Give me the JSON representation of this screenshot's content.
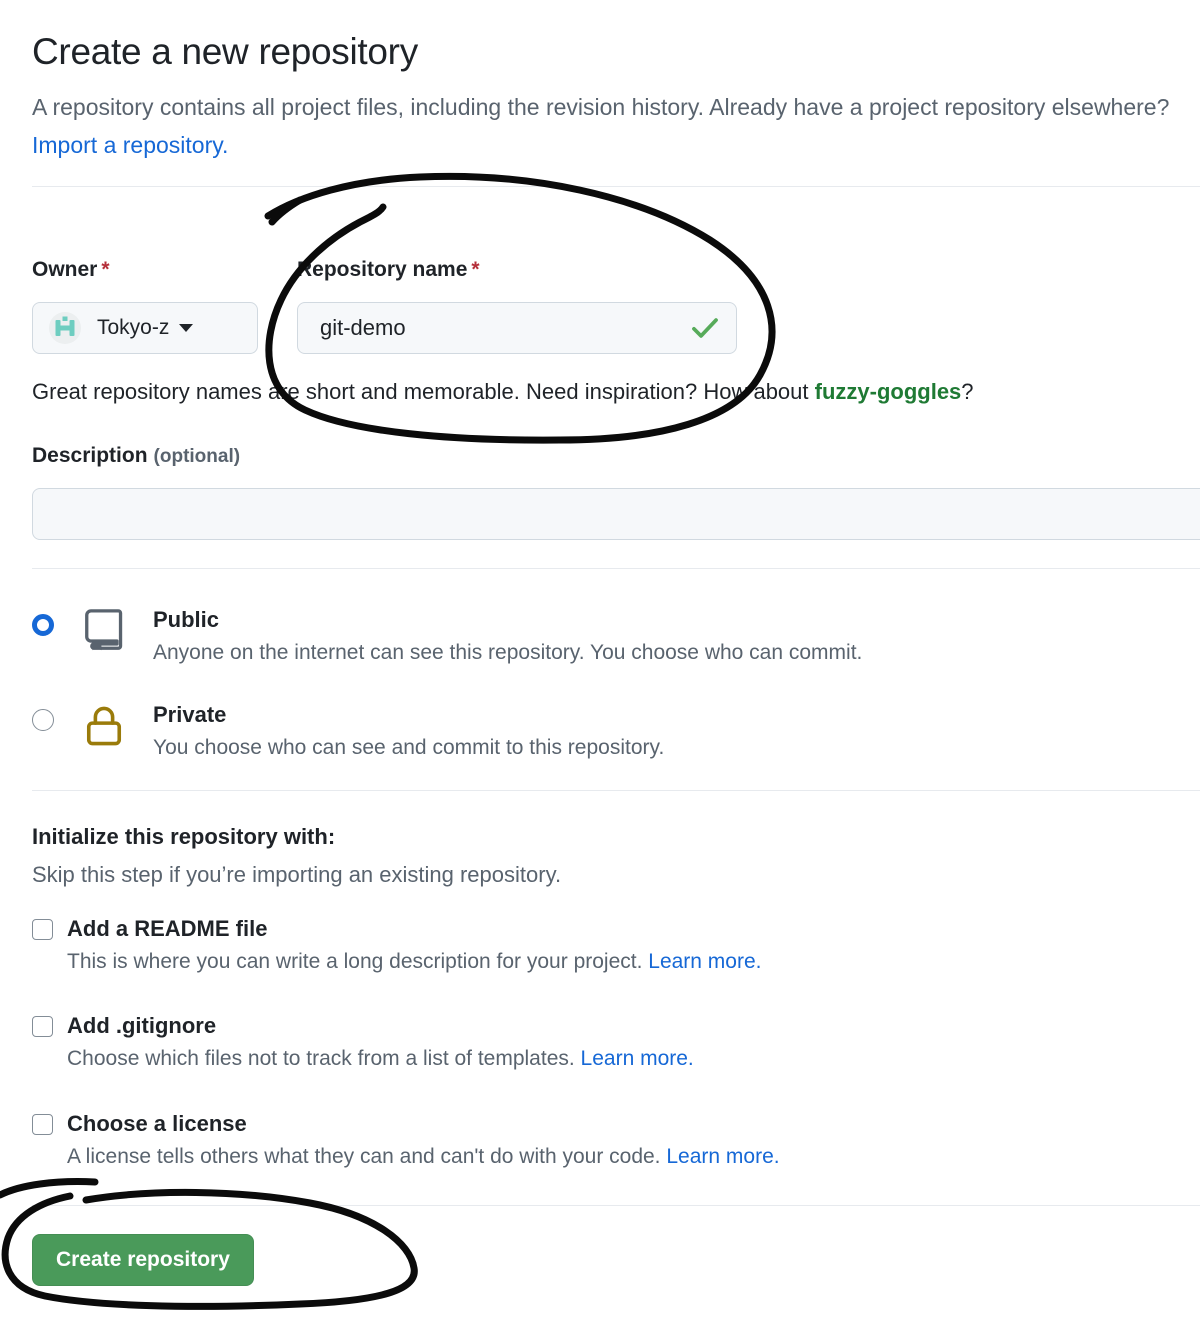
{
  "header": {
    "title": "Create a new repository",
    "subtitle_part1": "A repository contains all project files, including the revision history. Already have a project repository elsewhere? ",
    "subtitle_link": "Import a repository."
  },
  "owner": {
    "label": "Owner",
    "required_marker": "*",
    "value": "Tokyo-z",
    "avatar_icon": "user-avatar-identicon",
    "caret_icon": "chevron-down-icon"
  },
  "repository_name": {
    "label": "Repository name",
    "required_marker": "*",
    "value": "git-demo",
    "placeholder": "",
    "valid_icon": "check-icon",
    "valid_color": "#57ab5a"
  },
  "name_hint": {
    "text_before": "Great repository names are short and memorable. Need inspiration? How about ",
    "suggestion": "fuzzy-goggles",
    "text_after": "?"
  },
  "description": {
    "label": "Description",
    "optional_label": "(optional)",
    "value": "",
    "placeholder": ""
  },
  "visibility": {
    "options": [
      {
        "id": "public",
        "title": "Public",
        "description": "Anyone on the internet can see this repository. You choose who can commit.",
        "icon": "repo-book-icon",
        "icon_color": "#59636e",
        "selected": true
      },
      {
        "id": "private",
        "title": "Private",
        "description": "You choose who can see and commit to this repository.",
        "icon": "lock-icon",
        "icon_color": "#9a7b0a",
        "selected": false
      }
    ],
    "selected_color": "#1668d6"
  },
  "initialize": {
    "heading": "Initialize this repository with:",
    "subheading": "Skip this step if you’re importing an existing repository.",
    "items": [
      {
        "id": "readme",
        "title": "Add a README file",
        "description": "This is where you can write a long description for your project. ",
        "link": "Learn more.",
        "checked": false
      },
      {
        "id": "gitignore",
        "title": "Add .gitignore",
        "description": "Choose which files not to track from a list of templates. ",
        "link": "Learn more.",
        "checked": false
      },
      {
        "id": "license",
        "title": "Choose a license",
        "description": "A license tells others what they can and can't do with your code. ",
        "link": "Learn more.",
        "checked": false
      }
    ]
  },
  "submit": {
    "label": "Create repository",
    "color": "#4a9a5a"
  },
  "annotations": [
    {
      "id": "repo-name-circle",
      "shape": "hand-drawn-ellipse",
      "target": "repository-name-field",
      "color": "#000000"
    },
    {
      "id": "create-button-circle",
      "shape": "hand-drawn-ellipse",
      "target": "create-repository-button",
      "color": "#000000"
    }
  ],
  "colors": {
    "link": "#1668d6",
    "muted_text": "#59636e",
    "text": "#1f2328",
    "border": "#d1d9e0",
    "field_bg": "#f6f8fa",
    "required": "#b5303a",
    "suggestion_green": "#1f7a34"
  }
}
